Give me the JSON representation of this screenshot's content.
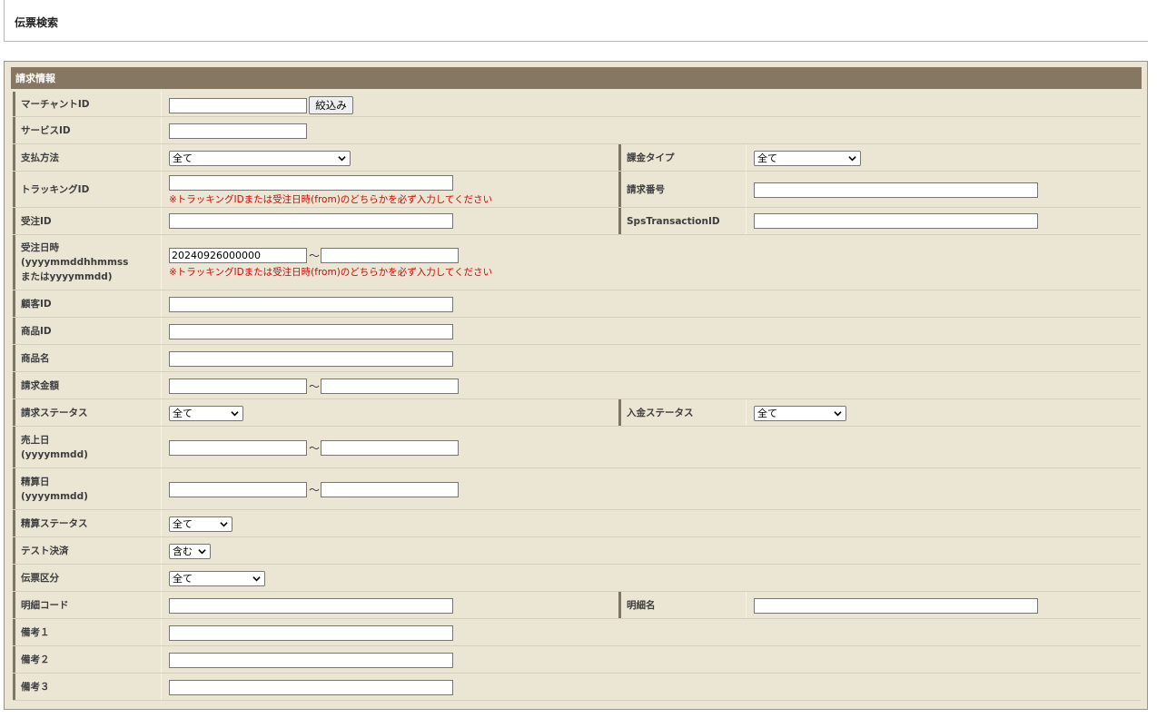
{
  "page": {
    "title": "伝票検索"
  },
  "panel": {
    "title": "請求情報"
  },
  "fields": {
    "merchant_id": {
      "label": "マーチャントID",
      "value": ""
    },
    "filter_button": "絞込み",
    "service_id": {
      "label": "サービスID",
      "value": ""
    },
    "payment_method": {
      "label": "支払方法",
      "selected": "全て"
    },
    "billing_type": {
      "label": "課金タイプ",
      "selected": "全て"
    },
    "tracking_id": {
      "label": "トラッキングID",
      "value": ""
    },
    "tracking_note": "※トラッキングIDまたは受注日時(from)のどちらかを必ず入力してください",
    "invoice_number": {
      "label": "請求番号",
      "value": ""
    },
    "order_id": {
      "label": "受注ID",
      "value": ""
    },
    "sps_transaction_id": {
      "label": "SpsTransactionID",
      "value": ""
    },
    "order_datetime": {
      "label_line1": "受注日時",
      "label_line2": "(yyyymmddhhmmss",
      "label_line3": "またはyyyymmdd)",
      "from": "20240926000000",
      "to": "",
      "note": "※トラッキングIDまたは受注日時(from)のどちらかを必ず入力してください"
    },
    "customer_id": {
      "label": "顧客ID",
      "value": ""
    },
    "product_id": {
      "label": "商品ID",
      "value": ""
    },
    "product_name": {
      "label": "商品名",
      "value": ""
    },
    "billing_amount": {
      "label": "請求金額",
      "from": "",
      "to": ""
    },
    "billing_status": {
      "label": "請求ステータス",
      "selected": "全て"
    },
    "payment_status": {
      "label": "入金ステータス",
      "selected": "全て"
    },
    "sales_date": {
      "label_line1": "売上日",
      "label_line2": "(yyyymmdd)",
      "from": "",
      "to": ""
    },
    "settlement_date": {
      "label_line1": "精算日",
      "label_line2": "(yyyymmdd)",
      "from": "",
      "to": ""
    },
    "settlement_status": {
      "label": "精算ステータス",
      "selected": "全て"
    },
    "test_payment": {
      "label": "テスト決済",
      "selected": "含む"
    },
    "slip_type": {
      "label": "伝票区分",
      "selected": "全て"
    },
    "detail_code": {
      "label": "明細コード",
      "value": ""
    },
    "detail_name": {
      "label": "明細名",
      "value": ""
    },
    "remarks1": {
      "label": "備考１",
      "value": ""
    },
    "remarks2": {
      "label": "備考２",
      "value": ""
    },
    "remarks3": {
      "label": "備考３",
      "value": ""
    },
    "range_separator": "～"
  },
  "icons": {
    "select_caret": "chevron-down-icon"
  }
}
